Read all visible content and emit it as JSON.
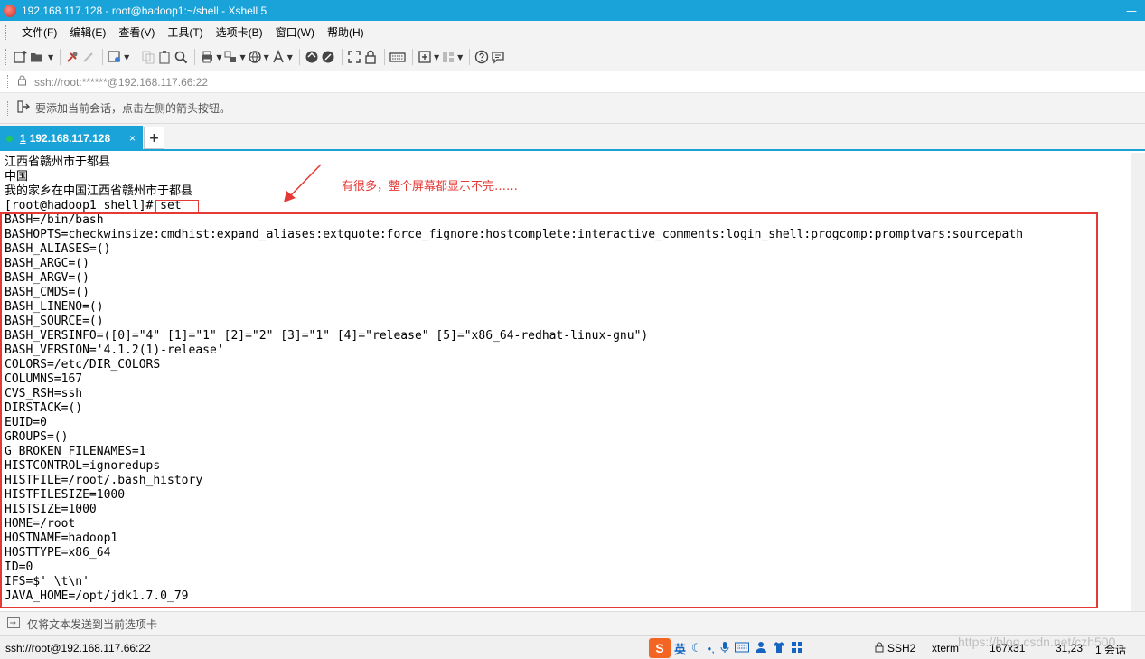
{
  "window": {
    "title": "192.168.117.128 - root@hadoop1:~/shell - Xshell 5",
    "minimize_glyph": "—"
  },
  "menu": [
    "文件(F)",
    "编辑(E)",
    "查看(V)",
    "工具(T)",
    "选项卡(B)",
    "窗口(W)",
    "帮助(H)"
  ],
  "address": {
    "value": "ssh://root:******@192.168.117.66:22"
  },
  "hint": {
    "text": "要添加当前会话，点击左侧的箭头按钮。"
  },
  "tab": {
    "number": "1",
    "label": "192.168.117.128",
    "close_glyph": "×",
    "add_glyph": "+"
  },
  "terminal": {
    "lines": [
      "江西省赣州市于都县",
      "中国",
      "我的家乡在中国江西省赣州市于都县",
      "[root@hadoop1 shell]# set",
      "BASH=/bin/bash",
      "BASHOPTS=checkwinsize:cmdhist:expand_aliases:extquote:force_fignore:hostcomplete:interactive_comments:login_shell:progcomp:promptvars:sourcepath",
      "BASH_ALIASES=()",
      "BASH_ARGC=()",
      "BASH_ARGV=()",
      "BASH_CMDS=()",
      "BASH_LINENO=()",
      "BASH_SOURCE=()",
      "BASH_VERSINFO=([0]=\"4\" [1]=\"1\" [2]=\"2\" [3]=\"1\" [4]=\"release\" [5]=\"x86_64-redhat-linux-gnu\")",
      "BASH_VERSION='4.1.2(1)-release'",
      "COLORS=/etc/DIR_COLORS",
      "COLUMNS=167",
      "CVS_RSH=ssh",
      "DIRSTACK=()",
      "EUID=0",
      "GROUPS=()",
      "G_BROKEN_FILENAMES=1",
      "HISTCONTROL=ignoredups",
      "HISTFILE=/root/.bash_history",
      "HISTFILESIZE=1000",
      "HISTSIZE=1000",
      "HOME=/root",
      "HOSTNAME=hadoop1",
      "HOSTTYPE=x86_64",
      "ID=0",
      "IFS=$' \\t\\n'",
      "JAVA_HOME=/opt/jdk1.7.0_79"
    ]
  },
  "annotation": {
    "text": "有很多，整个屏幕都显示不完……",
    "color": "#e53935"
  },
  "sendbar": {
    "text": "仅将文本发送到当前选项卡"
  },
  "status": {
    "connection": "ssh://root@192.168.117.66:22",
    "ime_logo": "S",
    "ime_lang": "英",
    "protocol": "SSH2",
    "term": "xterm",
    "size": "167x31",
    "cursor": "31,23",
    "sessions": "1 会话"
  },
  "watermark": "https://blog.csdn.net/czh500",
  "colors": {
    "accent": "#19a3d9",
    "annotation": "#e53935"
  }
}
